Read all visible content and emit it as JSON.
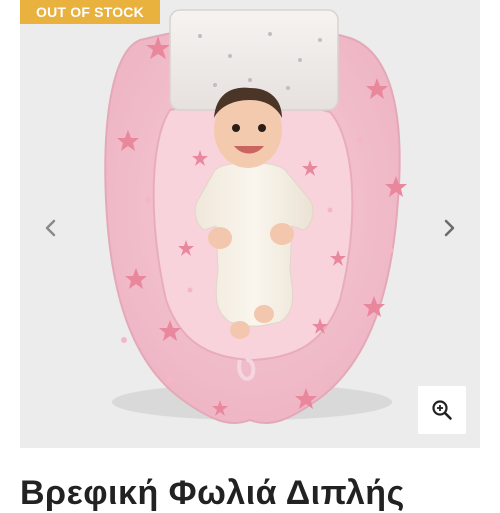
{
  "badge": {
    "label": "OUT OF STOCK"
  },
  "gallery": {
    "prev_icon": "chevron-left-icon",
    "next_icon": "chevron-right-icon",
    "zoom_icon": "zoom-in-icon"
  },
  "product": {
    "title": "Βρεφική Φωλιά Διπλής"
  },
  "colors": {
    "badge": "#e9b23f",
    "nest": "#f4c3cf",
    "star": "#e9879d",
    "background": "#ececec"
  }
}
